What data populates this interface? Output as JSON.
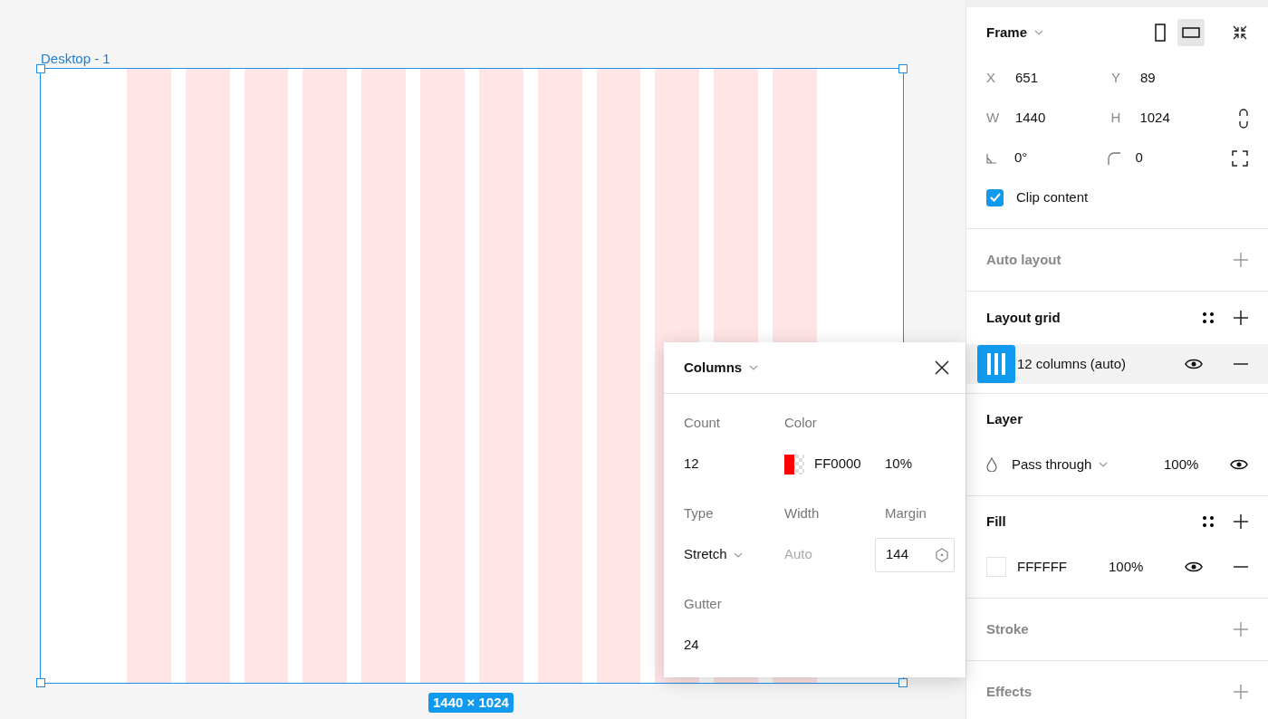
{
  "canvas": {
    "frame": {
      "title": "Desktop - 1",
      "size_label": "1440 × 1024",
      "selected": true
    }
  },
  "grid_popover": {
    "title": "Columns",
    "count": {
      "label": "Count",
      "value": "12"
    },
    "color": {
      "label": "Color",
      "hex": "FF0000",
      "opacity": "10%",
      "color": "#ff0000",
      "level": 0.1
    },
    "type": {
      "label": "Type",
      "value": "Stretch"
    },
    "width": {
      "label": "Width",
      "value": "Auto",
      "disabled": true
    },
    "margin": {
      "label": "Margin",
      "value": "144"
    },
    "gutter": {
      "label": "Gutter",
      "value": "24"
    }
  },
  "right_panel": {
    "frame": {
      "title": "Frame",
      "orientations": [
        {
          "kind": "portrait",
          "selected": false
        },
        {
          "kind": "landscape",
          "selected": true
        }
      ],
      "fields": [
        {
          "label": "X",
          "value": "651"
        },
        {
          "label": "Y",
          "value": "89"
        },
        {
          "label": "W",
          "value": "1440"
        },
        {
          "label": "H",
          "value": "1024"
        }
      ],
      "rotation": "0°",
      "corner_radius": "0",
      "clip_content": {
        "label": "Clip content",
        "checked": true
      }
    },
    "auto_layout": {
      "title": "Auto layout",
      "empty": true
    },
    "layout_grid": {
      "title": "Layout grid",
      "empty": false,
      "items": [
        {
          "label": "12 columns (auto)",
          "selected": true,
          "visible": true
        }
      ]
    },
    "layer": {
      "title": "Layer",
      "blend": "Pass through",
      "opacity": "100%",
      "visible": true
    },
    "fill": {
      "title": "Fill",
      "empty": false,
      "items": [
        {
          "hex": "FFFFFF",
          "opacity": "100%",
          "color": "#ffffff",
          "visible": true
        }
      ]
    },
    "stroke": {
      "title": "Stroke",
      "empty": true
    },
    "effects": {
      "title": "Effects",
      "empty": true
    }
  }
}
